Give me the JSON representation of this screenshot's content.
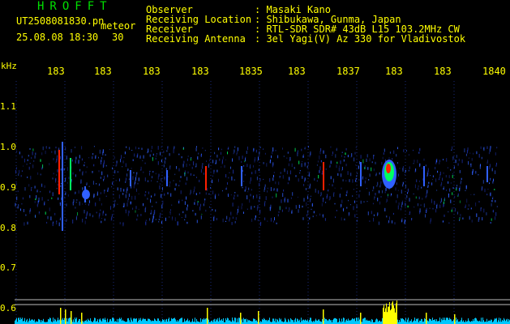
{
  "app_title": "HROFFT",
  "file": {
    "name": "UT2508081830.pn",
    "kind": "meteor",
    "datetime": "25.08.08 18:30",
    "interval": "30"
  },
  "info": [
    {
      "label": "Observer",
      "value": ": Masaki Kano"
    },
    {
      "label": "Receiving Location",
      "value": ": Shibukawa, Gunma, Japan"
    },
    {
      "label": "Receiver",
      "value": ": RTL-SDR SDR# 43dB L15 103.2MHz CW"
    },
    {
      "label": "Receiving Antenna",
      "value": ": 3el Yagi(V) Az 330 for Vladivostok"
    }
  ],
  "axis": {
    "unit": "kHz",
    "x_ticks": [
      "183",
      "183",
      "183",
      "183",
      "1835",
      "183",
      "1837",
      "183",
      "183",
      "1840"
    ],
    "y_ticks": [
      "1.1",
      "1.0",
      "0.9",
      "0.8",
      "0.7",
      "0.6"
    ]
  },
  "colors": {
    "background": "#000000",
    "text": "#ffff00",
    "title": "#00e000",
    "grid": "#1a2a7a",
    "signal_strong": "#ff2000",
    "signal_mid": "#00ff60",
    "signal_weak": "#3060ff",
    "power_trace": "#00c8ff"
  }
}
